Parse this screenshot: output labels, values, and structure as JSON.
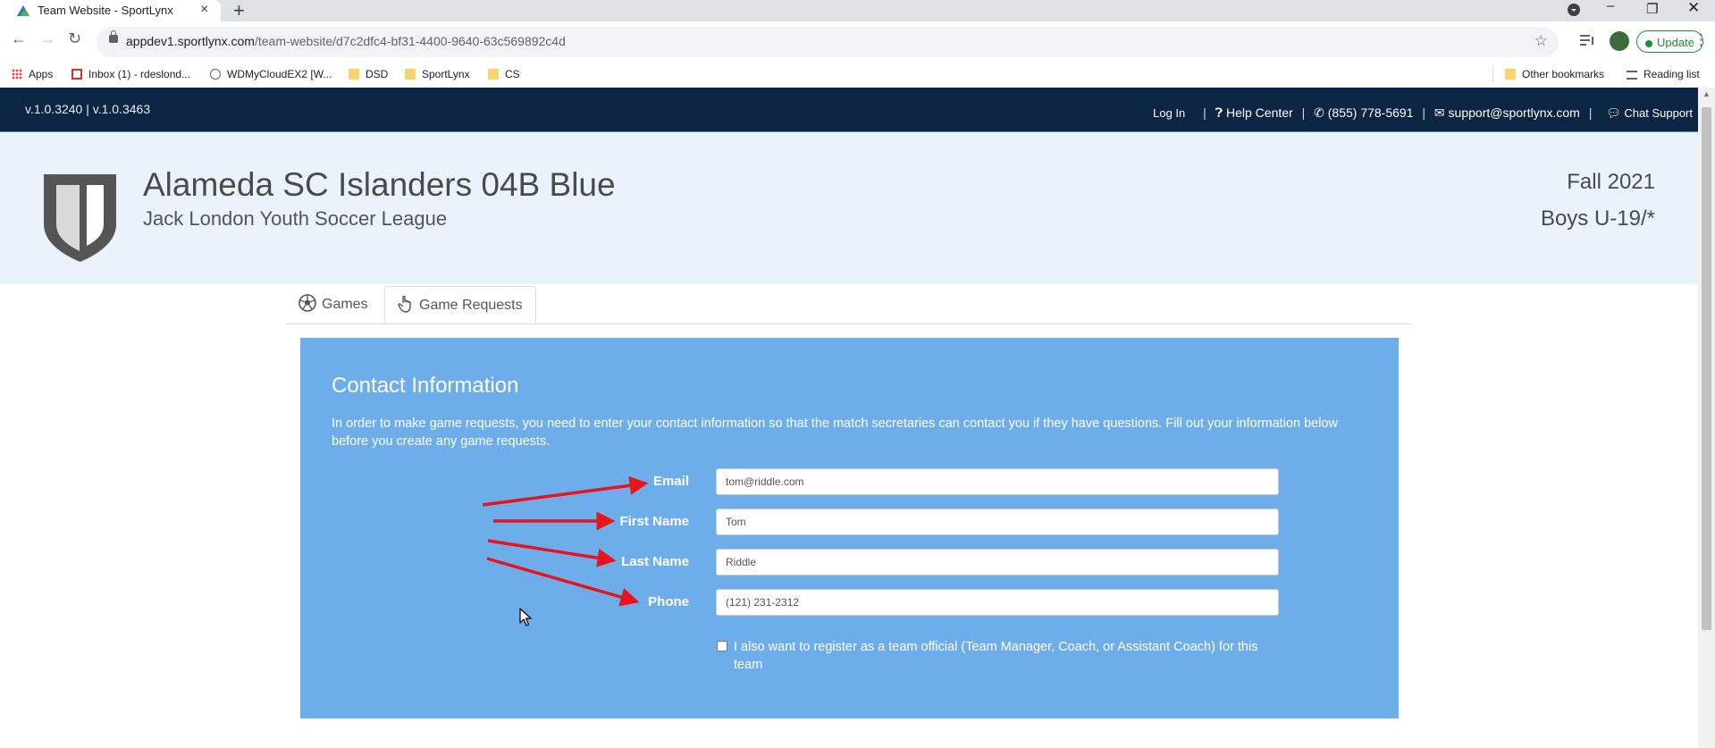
{
  "browser": {
    "tab_title": "Team Website - SportLynx",
    "url_domain": "appdev1.sportlynx.com",
    "url_path": "/team-website/d7c2dfc4-bf31-4400-9640-63c569892c4d",
    "update_label": "Update",
    "bookmarks": [
      {
        "label": "Apps",
        "icon": "apps-grid-icon"
      },
      {
        "label": "Inbox (1) - rdeslond...",
        "icon": "gmail-icon"
      },
      {
        "label": "WDMyCloudEX2 [W...",
        "icon": "globe-icon"
      },
      {
        "label": "DSD",
        "icon": "folder-icon"
      },
      {
        "label": "SportLynx",
        "icon": "folder-icon"
      },
      {
        "label": "CS",
        "icon": "folder-icon"
      }
    ],
    "other_bookmarks": "Other bookmarks",
    "reading_list": "Reading list"
  },
  "site": {
    "version": "v.1.0.3240 | v.1.0.3463",
    "nav": {
      "login": "Log In",
      "help": "Help Center",
      "phone": "(855) 778-5691",
      "email": "support@sportlynx.com",
      "chat": "Chat Support"
    }
  },
  "team": {
    "name": "Alameda SC Islanders 04B Blue",
    "league": "Jack London Youth Soccer League",
    "season": "Fall 2021",
    "division": "Boys U-19/*"
  },
  "tabs": [
    {
      "label": "Games",
      "icon": "soccer-ball-icon"
    },
    {
      "label": "Game Requests",
      "icon": "hand-pointer-icon"
    }
  ],
  "contact": {
    "title": "Contact Information",
    "intro": "In order to make game requests, you need to enter your contact information so that the match secretaries can contact you if they have questions. Fill out your information below before you create any game requests.",
    "fields": {
      "email": {
        "label": "Email",
        "value": "tom@riddle.com"
      },
      "first_name": {
        "label": "First Name",
        "value": "Tom"
      },
      "last_name": {
        "label": "Last Name",
        "value": "Riddle"
      },
      "phone": {
        "label": "Phone",
        "value": "(121) 231-2312"
      }
    },
    "official_checkbox": "I also want to register as a team official (Team Manager, Coach, or Assistant Coach) for this team"
  },
  "colors": {
    "site_bar": "#0b2542",
    "header_bg": "#eaf3fb",
    "panel_bg": "#6daeea",
    "annotation_arrow": "#e8141c"
  }
}
